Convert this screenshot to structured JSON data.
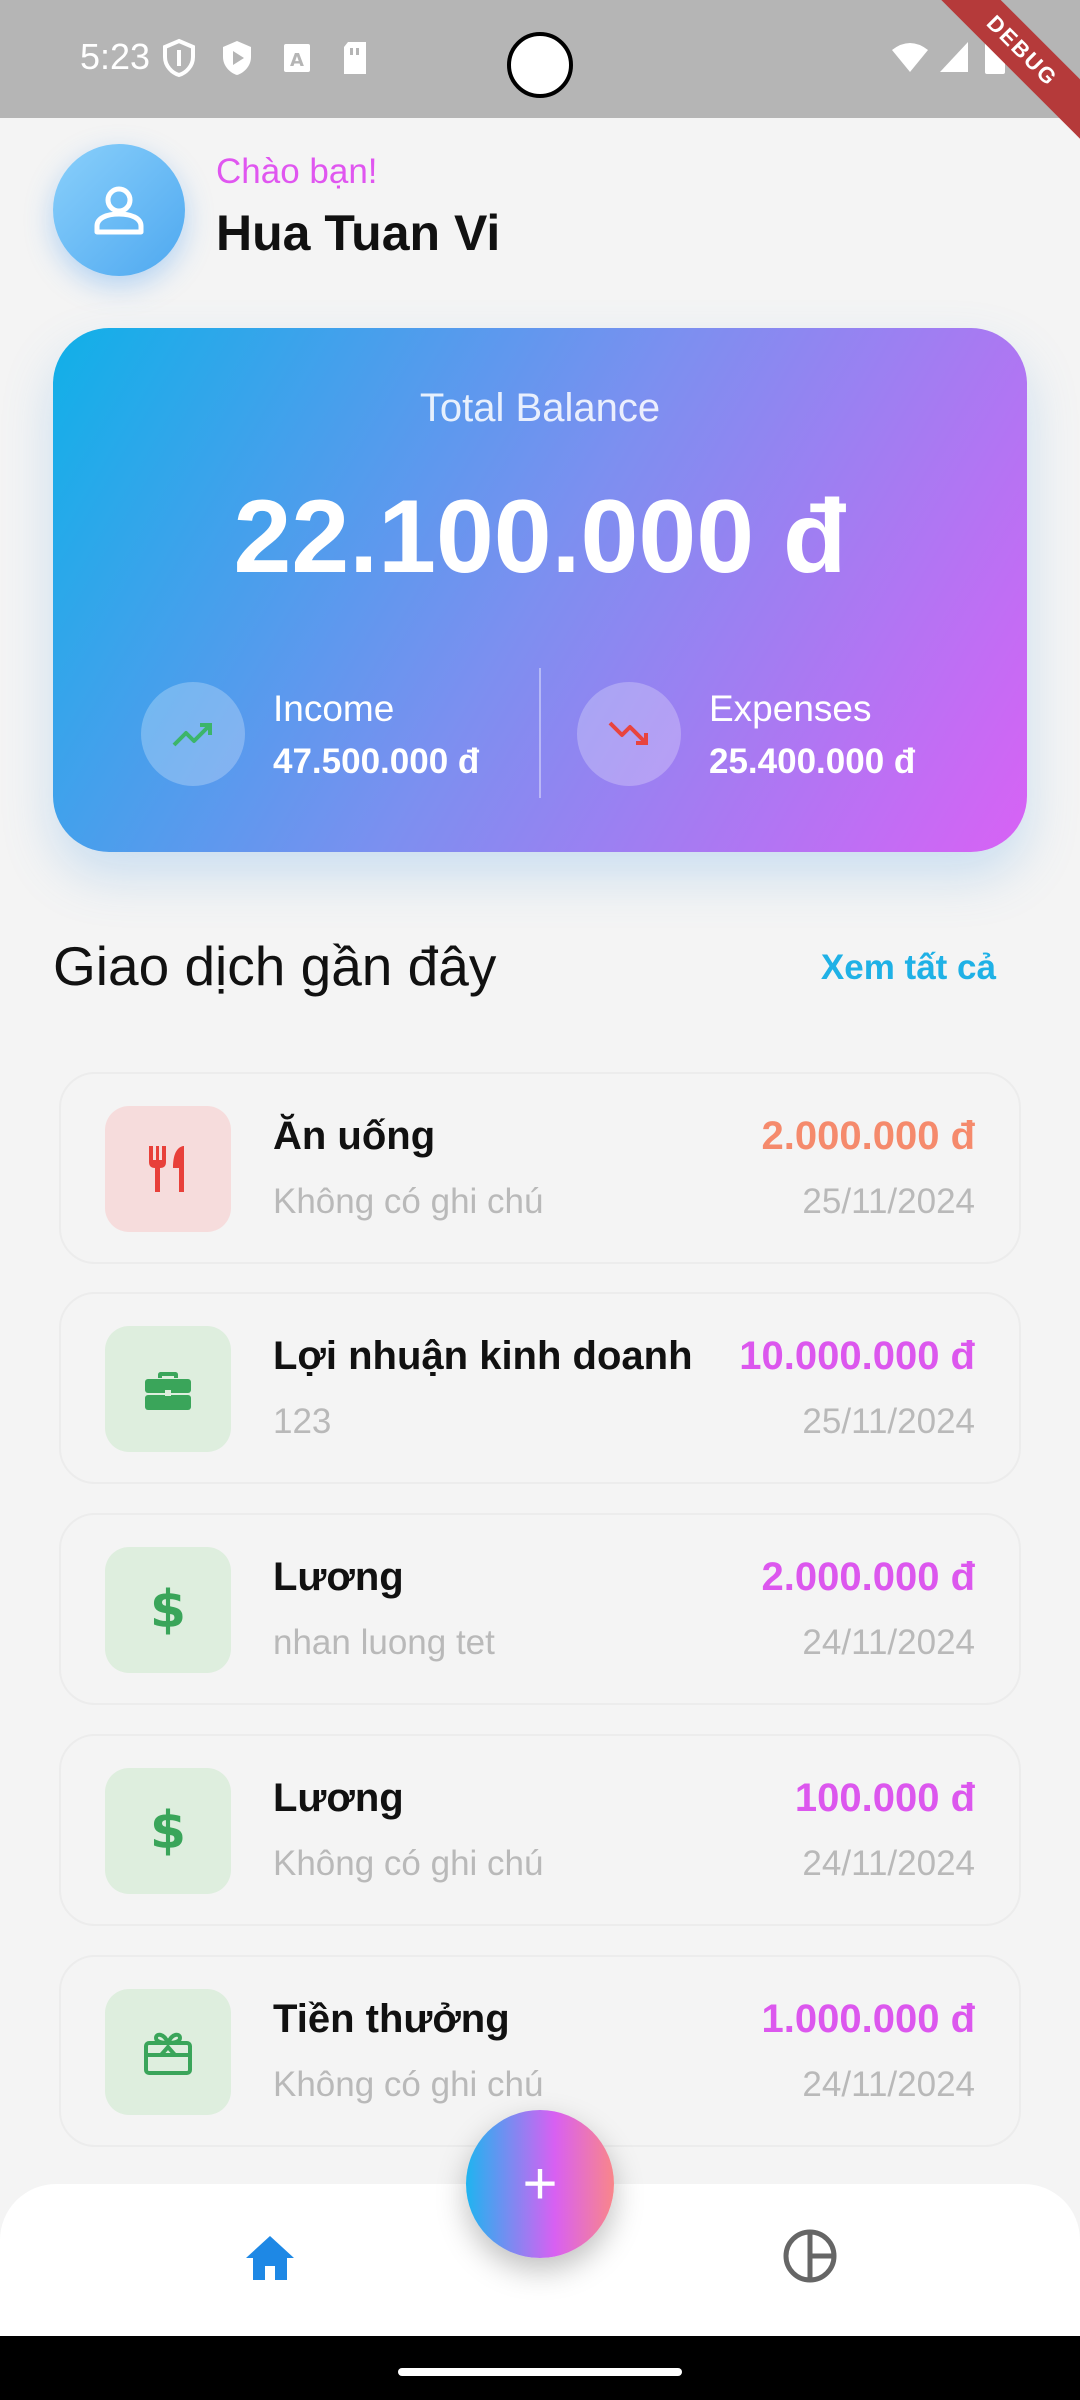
{
  "status_bar": {
    "time": "5:23",
    "debug_label": "DEBUG"
  },
  "header": {
    "greeting": "Chào bạn!",
    "user_name": "Hua Tuan Vi"
  },
  "balance": {
    "label": "Total Balance",
    "amount": "22.100.000 đ",
    "income_label": "Income",
    "income_value": "47.500.000 đ",
    "expenses_label": "Expenses",
    "expenses_value": "25.400.000 đ"
  },
  "section": {
    "title": "Giao dịch gần đây",
    "see_all": "Xem tất cả"
  },
  "transactions": [
    {
      "title": "Ăn uống",
      "note": "Không có ghi chú",
      "amount": "2.000.000 đ",
      "date": "25/11/2024",
      "icon": "restaurant-icon",
      "type": "expense"
    },
    {
      "title": "Lợi nhuận kinh doanh",
      "note": "123",
      "amount": "10.000.000 đ",
      "date": "25/11/2024",
      "icon": "briefcase-icon",
      "type": "income"
    },
    {
      "title": "Lương",
      "note": "nhan luong tet",
      "amount": "2.000.000 đ",
      "date": "24/11/2024",
      "icon": "dollar-icon",
      "type": "income"
    },
    {
      "title": "Lương",
      "note": "Không có ghi chú",
      "amount": "100.000 đ",
      "date": "24/11/2024",
      "icon": "dollar-icon",
      "type": "income"
    },
    {
      "title": "Tiền thưởng",
      "note": "Không có ghi chú",
      "amount": "1.000.000 đ",
      "date": "24/11/2024",
      "icon": "gift-icon",
      "type": "income"
    }
  ],
  "fab": {
    "label": "+"
  },
  "colors": {
    "expense_amount": "#f58a6c",
    "income_amount": "#dc57ee",
    "expense_icon_bg": "#f6dcdc",
    "income_icon_bg": "#deeede",
    "accent": "#1fb1e6"
  }
}
